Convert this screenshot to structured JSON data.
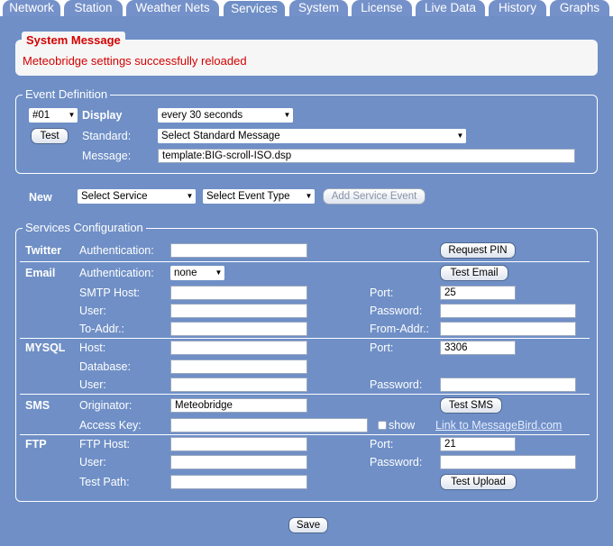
{
  "tabs": [
    "Network",
    "Station",
    "Weather Nets",
    "Services",
    "System",
    "License",
    "Live Data",
    "History",
    "Graphs"
  ],
  "active_tab": "Services",
  "system_message": {
    "title": "System Message",
    "text": "Meteobridge settings successfully reloaded"
  },
  "event": {
    "legend": "Event Definition",
    "number": "#01",
    "display_label": "Display",
    "display_value": "every 30 seconds",
    "test_button": "Test",
    "standard_label": "Standard:",
    "standard_value": "Select Standard Message",
    "message_label": "Message:",
    "message_value": "template:BIG-scroll-ISO.dsp"
  },
  "new_event": {
    "label": "New",
    "service_value": "Select Service",
    "event_type_value": "Select Event Type",
    "add_button": "Add Service Event"
  },
  "services": {
    "legend": "Services Configuration",
    "twitter": {
      "name": "Twitter",
      "auth_label": "Authentication:",
      "auth_value": "",
      "pin_button": "Request PIN"
    },
    "email": {
      "name": "Email",
      "auth_label": "Authentication:",
      "auth_value": "none",
      "test_button": "Test Email",
      "smtp_label": "SMTP Host:",
      "smtp_value": "",
      "port_label": "Port:",
      "port_value": "25",
      "user_label": "User:",
      "user_value": "",
      "password_label": "Password:",
      "password_value": "",
      "to_label": "To-Addr.:",
      "to_value": "",
      "from_label": "From-Addr.:",
      "from_value": ""
    },
    "mysql": {
      "name": "MYSQL",
      "host_label": "Host:",
      "host_value": "",
      "port_label": "Port:",
      "port_value": "3306",
      "db_label": "Database:",
      "db_value": "",
      "user_label": "User:",
      "user_value": "",
      "password_label": "Password:",
      "password_value": ""
    },
    "sms": {
      "name": "SMS",
      "originator_label": "Originator:",
      "originator_value": "Meteobridge",
      "test_button": "Test SMS",
      "key_label": "Access Key:",
      "key_value": "",
      "show_label": "show",
      "link_text": "Link to MessageBird.com"
    },
    "ftp": {
      "name": "FTP",
      "host_label": "FTP Host:",
      "host_value": "",
      "port_label": "Port:",
      "port_value": "21",
      "user_label": "User:",
      "user_value": "",
      "password_label": "Password:",
      "password_value": "",
      "path_label": "Test Path:",
      "path_value": "",
      "upload_button": "Test Upload"
    }
  },
  "save_button": "Save"
}
